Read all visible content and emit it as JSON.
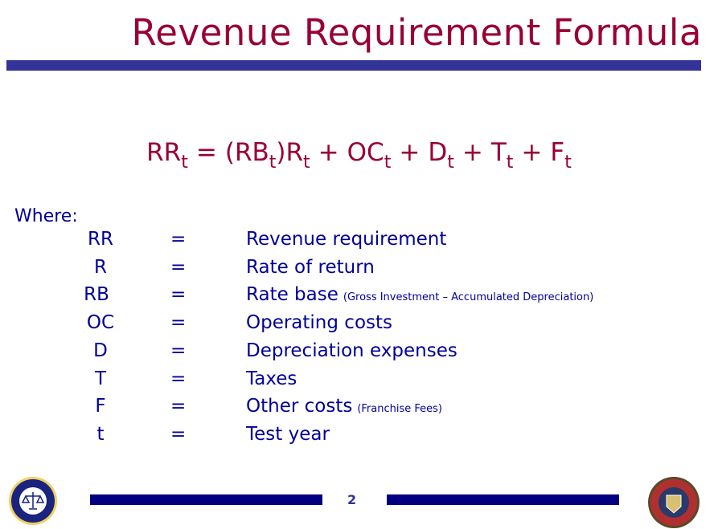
{
  "title": "Revenue Requirement Formula",
  "formula": [
    {
      "base": "RR",
      "sub": "t"
    },
    {
      "op": "="
    },
    {
      "base": "(RB",
      "sub": "t"
    },
    {
      "base": ")R",
      "sub": "t"
    },
    {
      "op": "+"
    },
    {
      "base": "OC",
      "sub": "t"
    },
    {
      "op": "+"
    },
    {
      "base": "D",
      "sub": "t"
    },
    {
      "op": "+"
    },
    {
      "base": "T",
      "sub": "t"
    },
    {
      "op": "+"
    },
    {
      "base": "F",
      "sub": "t"
    }
  ],
  "where_label": "Where:",
  "definitions": [
    {
      "symbol": "RR",
      "eq": "=",
      "definition": "Revenue requirement",
      "note": ""
    },
    {
      "symbol": "R",
      "eq": "=",
      "definition": "Rate of return",
      "note": ""
    },
    {
      "symbol": "RB",
      "eq": "=",
      "definition": "Rate base",
      "note": "(Gross Investment – Accumulated Depreciation)"
    },
    {
      "symbol": "OC",
      "eq": "=",
      "definition": "Operating costs",
      "note": ""
    },
    {
      "symbol": "D",
      "eq": "=",
      "definition": "Depreciation expenses",
      "note": ""
    },
    {
      "symbol": "T",
      "eq": "=",
      "definition": "Taxes",
      "note": ""
    },
    {
      "symbol": "F",
      "eq": "=",
      "definition": "Other costs",
      "note": "(Franchise Fees)"
    },
    {
      "symbol": "t",
      "eq": "=",
      "definition": "Test year",
      "note": ""
    }
  ],
  "page_number": "2",
  "colors": {
    "title": "#990033",
    "text": "#000099",
    "bar": "#333399",
    "footer_bar": "#000080"
  },
  "logos": {
    "left": "regulatory-commissioners-seal",
    "right": "State of Colorado 1876"
  }
}
